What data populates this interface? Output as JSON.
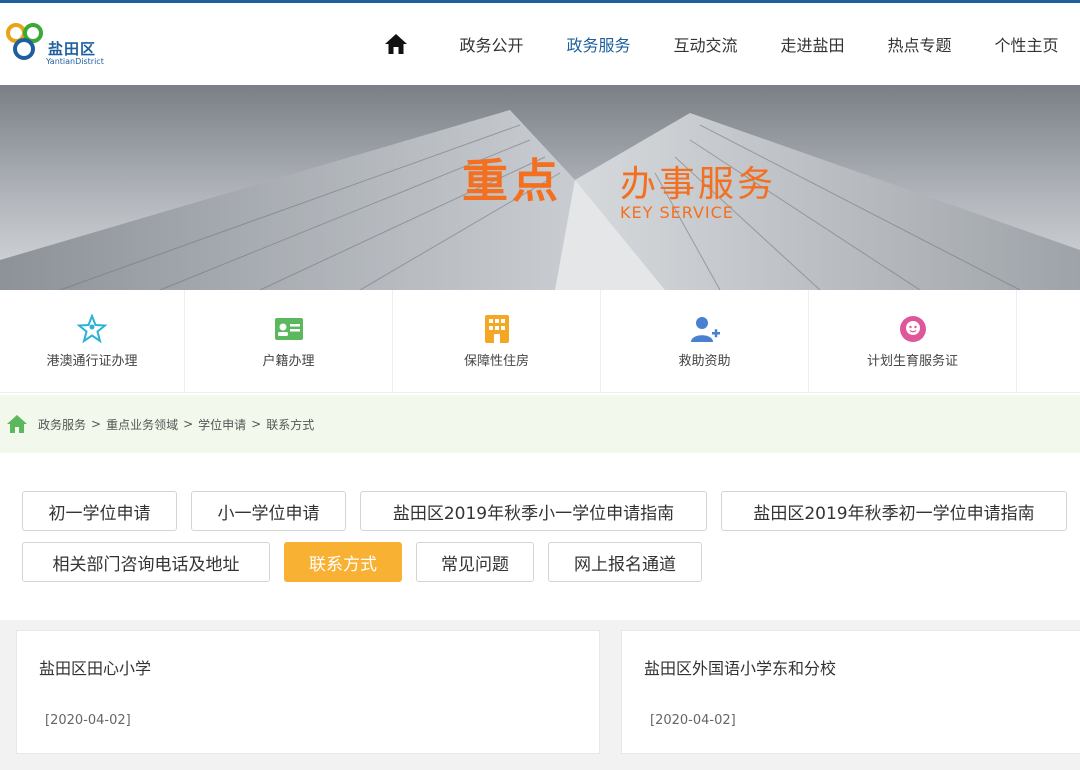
{
  "header": {
    "logo_text": "盐田区",
    "logo_sub": "YantianDistrict",
    "nav": [
      "政务公开",
      "政务服务",
      "互动交流",
      "走进盐田",
      "热点专题",
      "个性主页"
    ],
    "nav_active_index": 1
  },
  "banner": {
    "title_main": "重点",
    "title_rest": "办事服务",
    "subtitle": "KEY SERVICE"
  },
  "services": [
    {
      "label": "港澳通行证办理",
      "icon": "star-person-icon"
    },
    {
      "label": "户籍办理",
      "icon": "id-card-icon"
    },
    {
      "label": "保障性住房",
      "icon": "building-icon"
    },
    {
      "label": "救助资助",
      "icon": "user-add-icon"
    },
    {
      "label": "计划生育服务证",
      "icon": "baby-icon"
    }
  ],
  "breadcrumb": [
    "政务服务",
    "重点业务领域",
    "学位申请",
    "联系方式"
  ],
  "tabs": {
    "row1": [
      "初一学位申请",
      "小一学位申请",
      "盐田区2019年秋季小一学位申请指南",
      "盐田区2019年秋季初一学位申请指南"
    ],
    "row2": [
      "相关部门咨询电话及地址",
      "联系方式",
      "常见问题",
      "网上报名通道"
    ],
    "active": "联系方式"
  },
  "cards": [
    {
      "title": "盐田区田心小学",
      "date": "[2020-04-02]"
    },
    {
      "title": "盐田区外国语小学东和分校",
      "date": "[2020-04-02]"
    }
  ],
  "colors": {
    "brand_blue": "#1f5f9e",
    "accent_orange": "#f37021",
    "tab_active": "#f8b133",
    "crumb_bg": "#f2f9ec"
  }
}
